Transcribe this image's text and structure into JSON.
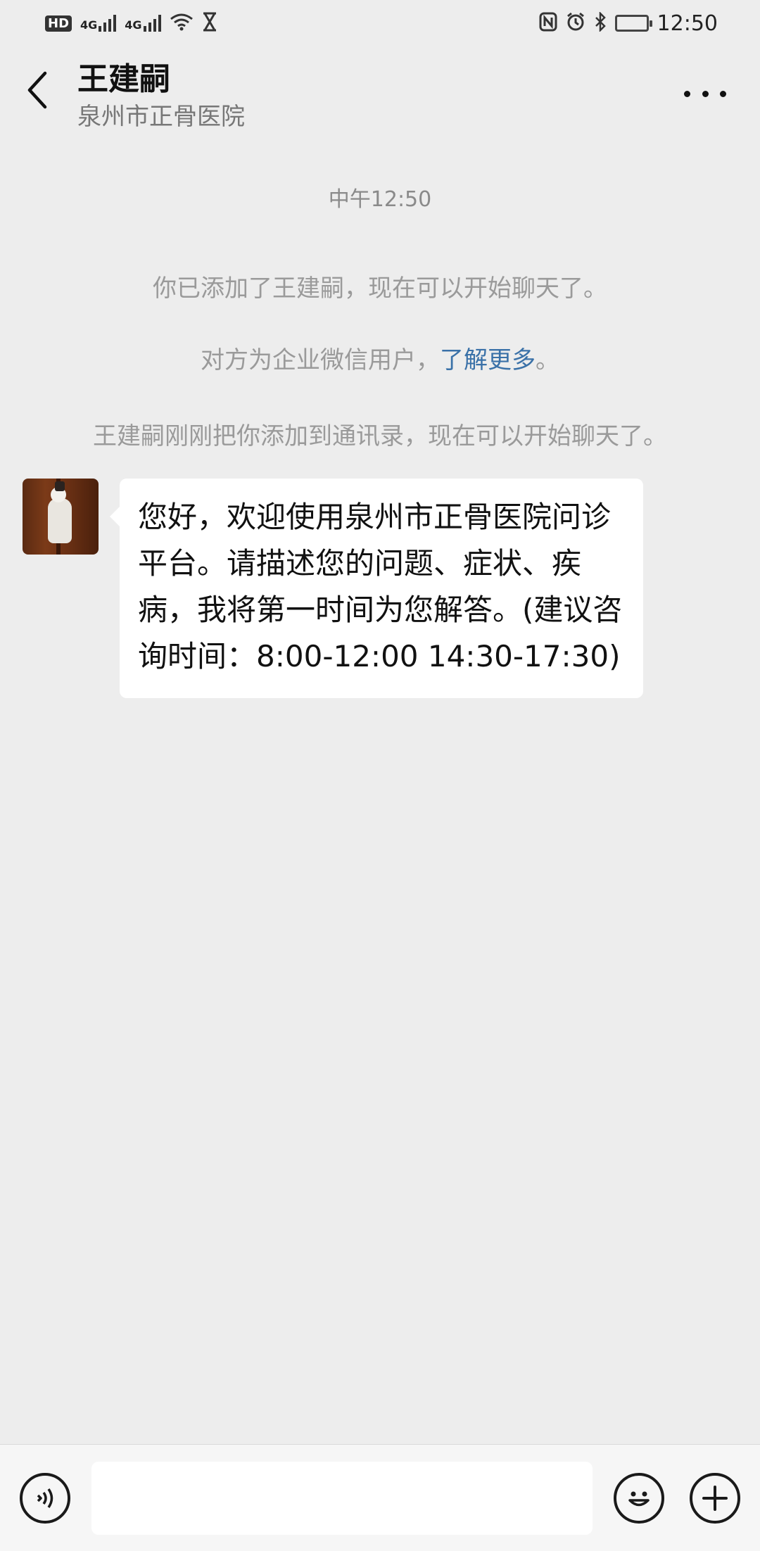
{
  "status_bar": {
    "hd": "HD",
    "net1": "4G",
    "net2": "4G",
    "time": "12:50",
    "icons": [
      "wifi-icon",
      "hourglass-icon",
      "nfc-icon",
      "alarm-icon",
      "bluetooth-icon",
      "battery-icon"
    ]
  },
  "header": {
    "title": "王建嗣",
    "subtitle": "泉州市正骨医院",
    "back_icon": "chevron-left-icon",
    "more_icon": "more-icon"
  },
  "chat": {
    "timestamp": "中午12:50",
    "system_1": "你已添加了王建嗣，现在可以开始聊天了。",
    "system_2_prefix": "对方为企业微信用户，",
    "system_2_link": "了解更多",
    "system_2_suffix": "。",
    "system_3": "王建嗣刚刚把你添加到通讯录，现在可以开始聊天了。",
    "message": "您好，欢迎使用泉州市正骨医院问诊平台。请描述您的问题、症状、疾病，我将第一时间为您解答。(建议咨询时间：8:00-12:00  14:30-17:30)"
  },
  "input_bar": {
    "voice_icon": "voice-icon",
    "emoji_icon": "emoji-icon",
    "plus_icon": "plus-icon"
  },
  "colors": {
    "background": "#ededed",
    "bubble": "#ffffff",
    "link": "#3a71a8",
    "system_text": "#9a9a9a"
  }
}
